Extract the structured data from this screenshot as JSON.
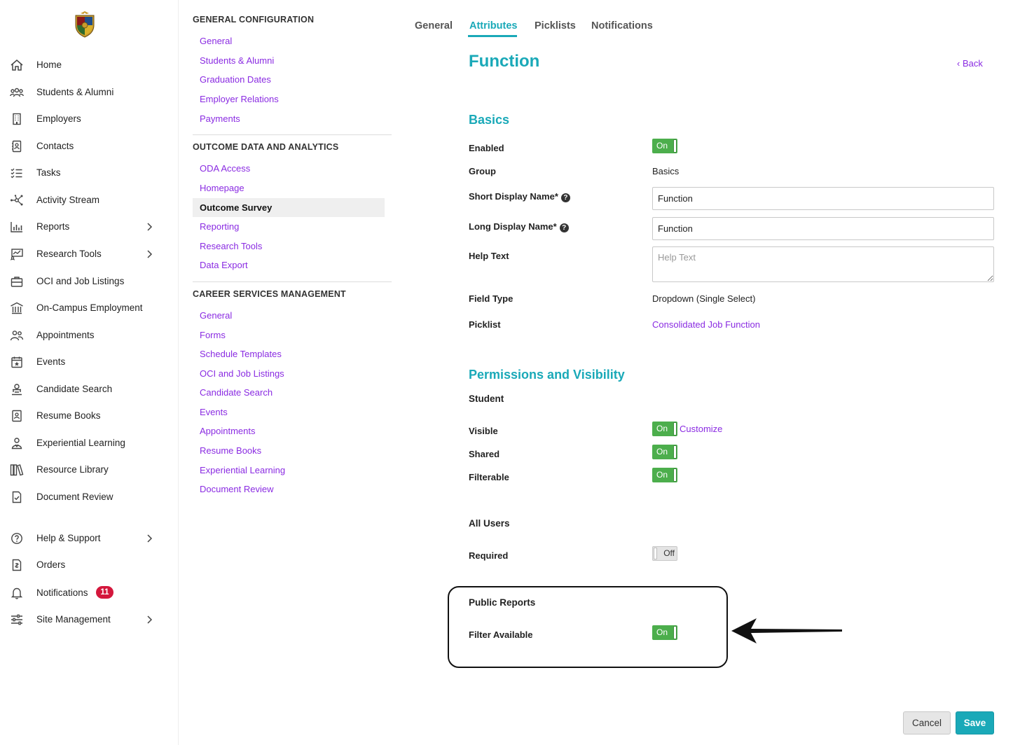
{
  "sidebar": {
    "items": [
      {
        "label": "Home",
        "icon": "home-icon"
      },
      {
        "label": "Students & Alumni",
        "icon": "users-icon"
      },
      {
        "label": "Employers",
        "icon": "building-icon"
      },
      {
        "label": "Contacts",
        "icon": "contact-card-icon"
      },
      {
        "label": "Tasks",
        "icon": "checklist-icon"
      },
      {
        "label": "Activity Stream",
        "icon": "network-icon"
      },
      {
        "label": "Reports",
        "icon": "bar-chart-icon"
      },
      {
        "label": "Research Tools",
        "icon": "research-chart-icon"
      },
      {
        "label": "OCI and Job Listings",
        "icon": "briefcase-icon"
      },
      {
        "label": "On-Campus Employment",
        "icon": "campus-building-icon"
      },
      {
        "label": "Appointments",
        "icon": "people-icon"
      },
      {
        "label": "Events",
        "icon": "calendar-star-icon"
      },
      {
        "label": "Candidate Search",
        "icon": "user-search-icon"
      },
      {
        "label": "Resume Books",
        "icon": "resume-book-icon"
      },
      {
        "label": "Experiential Learning",
        "icon": "learning-person-icon"
      },
      {
        "label": "Resource Library",
        "icon": "library-books-icon"
      },
      {
        "label": "Document Review",
        "icon": "document-check-icon"
      },
      {
        "label": "Help & Support",
        "icon": "help-circle-icon"
      },
      {
        "label": "Orders",
        "icon": "receipt-icon"
      },
      {
        "label": "Notifications",
        "icon": "bell-icon",
        "badge": "11"
      },
      {
        "label": "Site Management",
        "icon": "sliders-icon"
      }
    ]
  },
  "config_nav": {
    "sections": [
      {
        "title": "GENERAL CONFIGURATION",
        "links": [
          "General",
          "Students & Alumni",
          "Graduation Dates",
          "Employer Relations",
          "Payments"
        ]
      },
      {
        "title": "OUTCOME DATA AND ANALYTICS",
        "links": [
          "ODA Access",
          "Homepage",
          "Outcome Survey",
          "Reporting",
          "Research Tools",
          "Data Export"
        ]
      },
      {
        "title": "CAREER SERVICES MANAGEMENT",
        "links": [
          "General",
          "Forms",
          "Schedule Templates",
          "OCI and Job Listings",
          "Candidate Search",
          "Events",
          "Appointments",
          "Resume Books",
          "Experiential Learning",
          "Document Review"
        ]
      }
    ]
  },
  "tabs": [
    "General",
    "Attributes",
    "Picklists",
    "Notifications"
  ],
  "active_tab": "Attributes",
  "page": {
    "title": "Function",
    "back_label": "Back"
  },
  "basics": {
    "heading": "Basics",
    "enabled_label": "Enabled",
    "enabled_state": "On",
    "group_label": "Group",
    "group_value": "Basics",
    "short_name_label": "Short Display Name*",
    "short_name_value": "Function",
    "long_name_label": "Long Display Name*",
    "long_name_value": "Function",
    "help_text_label": "Help Text",
    "help_text_placeholder": "Help Text",
    "field_type_label": "Field Type",
    "field_type_value": "Dropdown (Single Select)",
    "picklist_label": "Picklist",
    "picklist_value": "Consolidated Job Function"
  },
  "permissions": {
    "heading": "Permissions and Visibility",
    "student_heading": "Student",
    "visible_label": "Visible",
    "visible_state": "On",
    "customize_label": "Customize",
    "shared_label": "Shared",
    "shared_state": "On",
    "filterable_label": "Filterable",
    "filterable_state": "On",
    "all_users_heading": "All Users",
    "required_label": "Required",
    "required_state": "Off",
    "public_reports_heading": "Public Reports",
    "filter_available_label": "Filter Available",
    "filter_available_state": "On"
  },
  "actions": {
    "cancel": "Cancel",
    "save": "Save"
  },
  "colors": {
    "accent": "#1aa9b8",
    "link": "#8a2be2",
    "toggle_on": "#4cae4c",
    "badge": "#d4173c"
  }
}
